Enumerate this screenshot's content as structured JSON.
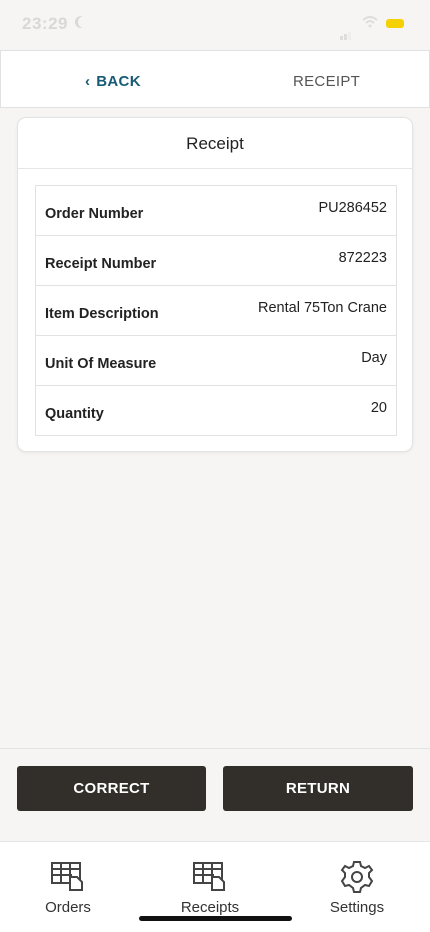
{
  "status": {
    "time": "23:29"
  },
  "header": {
    "back_label": "BACK",
    "title": "RECEIPT"
  },
  "card": {
    "title": "Receipt",
    "rows": [
      {
        "label": "Order Number",
        "value": "PU286452"
      },
      {
        "label": "Receipt Number",
        "value": "872223"
      },
      {
        "label": "Item Description",
        "value": "Rental 75Ton Crane"
      },
      {
        "label": "Unit Of Measure",
        "value": "Day"
      },
      {
        "label": "Quantity",
        "value": "20"
      }
    ]
  },
  "actions": {
    "correct_label": "CORRECT",
    "return_label": "RETURN"
  },
  "tabs": [
    {
      "label": "Orders",
      "icon": "orders-icon"
    },
    {
      "label": "Receipts",
      "icon": "receipts-icon"
    },
    {
      "label": "Settings",
      "icon": "gear-icon"
    }
  ],
  "colors": {
    "accent": "#165b76",
    "button": "#322e2a",
    "battery": "#f5d100"
  }
}
